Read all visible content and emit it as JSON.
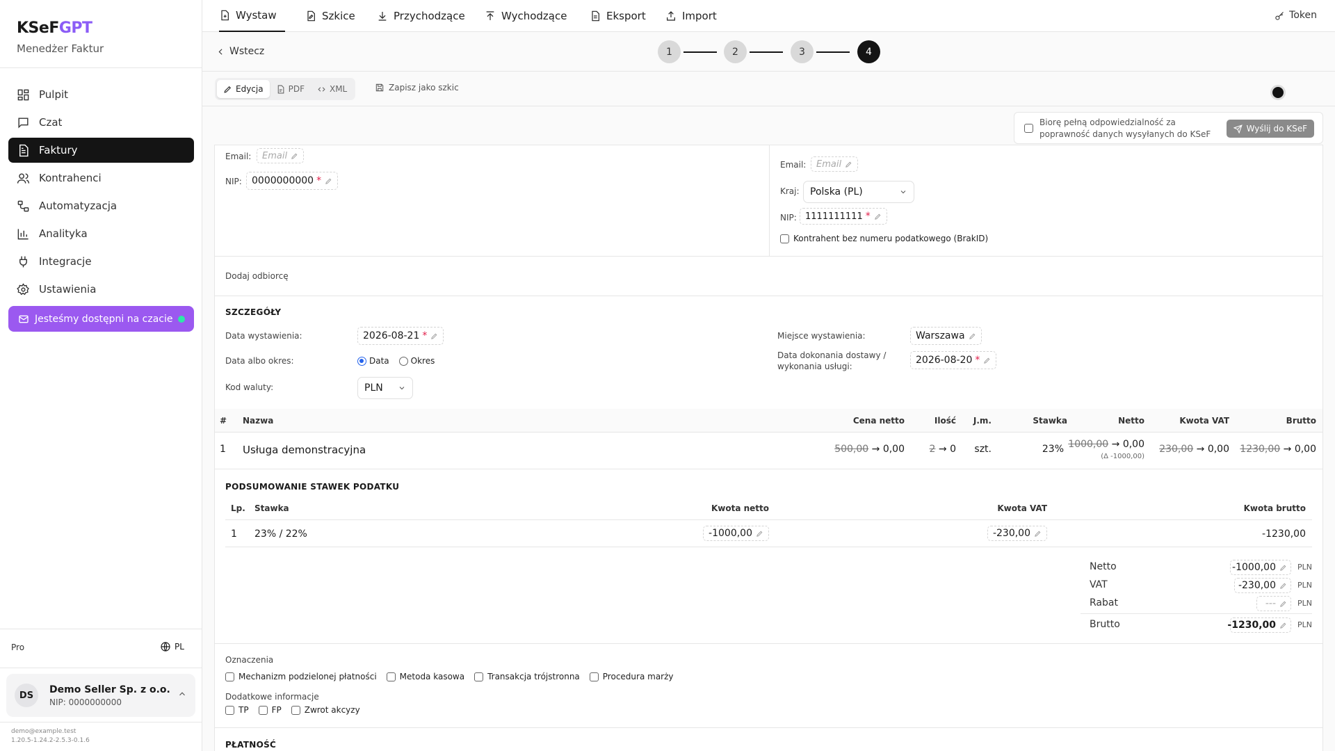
{
  "app": {
    "brand_main": "KSeF",
    "brand_accent": "GPT",
    "subtitle": "Menedżer Faktur"
  },
  "sidebar": {
    "items": [
      {
        "label": "Pulpit",
        "icon": "dashboard-icon"
      },
      {
        "label": "Czat",
        "icon": "chat-icon"
      },
      {
        "label": "Faktury",
        "icon": "invoice-icon",
        "active": true
      },
      {
        "label": "Kontrahenci",
        "icon": "users-icon"
      },
      {
        "label": "Automatyzacja",
        "icon": "workflow-icon"
      },
      {
        "label": "Analityka",
        "icon": "analytics-icon"
      },
      {
        "label": "Integracje",
        "icon": "plug-icon"
      },
      {
        "label": "Ustawienia",
        "icon": "gear-icon"
      }
    ],
    "chat_cta": "Jesteśmy dostępni na czacie",
    "plan": "Pro",
    "language": "PL",
    "user": {
      "initials": "DS",
      "name": "Demo Seller Sp. z o.o.",
      "nip": "NIP: 0000000000"
    },
    "email": "demo@example.test",
    "version": "1.20.5-1.24.2-2.5.3-0.1.6"
  },
  "topnav": {
    "tabs": [
      {
        "label": "Wystaw",
        "icon": "file-plus-icon",
        "active": true
      },
      {
        "label": "Szkice",
        "icon": "draft-icon"
      },
      {
        "label": "Przychodzące",
        "icon": "download-icon"
      },
      {
        "label": "Wychodzące",
        "icon": "upload-icon"
      },
      {
        "label": "Eksport",
        "icon": "export-icon"
      },
      {
        "label": "Import",
        "icon": "import-icon"
      }
    ],
    "token_label": "Token"
  },
  "wizard": {
    "back_label": "Wstecz",
    "steps": [
      "1",
      "2",
      "3",
      "4"
    ],
    "current_step": 4
  },
  "toolbar": {
    "modes": [
      {
        "label": "Edycja",
        "icon": "pencil-icon",
        "active": true
      },
      {
        "label": "PDF",
        "icon": "pdf-icon"
      },
      {
        "label": "XML",
        "icon": "code-icon"
      }
    ],
    "save_draft": "Zapisz jako szkic"
  },
  "send": {
    "confirm_text": "Biorę pełną odpowiedzialność za poprawność danych wysyłanych do KSeF",
    "button": "Wyślij do KSeF",
    "confirmed": false
  },
  "seller": {
    "email_label": "Email:",
    "email_placeholder": "Email",
    "nip_label": "NIP:",
    "nip": "0000000000"
  },
  "buyer": {
    "email_label": "Email:",
    "email_placeholder": "Email",
    "country_label": "Kraj:",
    "country": "Polska (PL)",
    "nip_label": "NIP:",
    "nip": "1111111111",
    "no_tax_id_label": "Kontrahent bez numeru podatkowego (BrakID)",
    "no_tax_id": false
  },
  "add_recipient": "Dodaj odbiorcę",
  "details": {
    "title": "SZCZEGÓŁY",
    "issue_date_label": "Data wystawienia:",
    "issue_date": "2026-08-21",
    "date_or_period_label": "Data albo okres:",
    "date_option": "Data",
    "period_option": "Okres",
    "selected": "Data",
    "currency_label": "Kod waluty:",
    "currency": "PLN",
    "place_label": "Miejsce wystawienia:",
    "place": "Warszawa",
    "delivery_label_1": "Data dokonania dostawy /",
    "delivery_label_2": "wykonania usługi:",
    "delivery_date": "2026-08-20"
  },
  "items_table": {
    "headers": {
      "idx": "#",
      "name": "Nazwa",
      "net_price": "Cena netto",
      "qty": "Ilość",
      "unit": "J.m.",
      "rate": "Stawka",
      "net": "Netto",
      "vat": "Kwota VAT",
      "gross": "Brutto"
    },
    "rows": [
      {
        "idx": "1",
        "name": "Usługa demonstracyjna",
        "net_price_old": "500,00",
        "net_price_new": "→ 0,00",
        "qty_old": "2",
        "qty_new": "→ 0",
        "unit": "szt.",
        "rate": "23%",
        "net_old": "1000,00",
        "net_new": "→ 0,00",
        "net_delta": "(Δ -1000,00)",
        "vat_old": "230,00",
        "vat_new": "→ 0,00",
        "gross_old": "1230,00",
        "gross_new": "→ 0,00"
      }
    ]
  },
  "tax_summary": {
    "title": "PODSUMOWANIE STAWEK PODATKU",
    "headers": {
      "lp": "Lp.",
      "rate": "Stawka",
      "net": "Kwota netto",
      "vat": "Kwota VAT",
      "gross": "Kwota brutto"
    },
    "rows": [
      {
        "lp": "1",
        "rate": "23% / 22%",
        "net": "-1000,00",
        "vat": "-230,00",
        "gross": "-1230,00"
      }
    ]
  },
  "totals": {
    "currency": "PLN",
    "netto_label": "Netto",
    "netto": "-1000,00",
    "vat_label": "VAT",
    "vat": "-230,00",
    "rabat_label": "Rabat",
    "rabat": "---",
    "brutto_label": "Brutto",
    "brutto": "-1230,00"
  },
  "flags": {
    "title": "Oznaczenia",
    "items": [
      "Mechanizm podzielonej płatności",
      "Metoda kasowa",
      "Transakcja trójstronna",
      "Procedura marży"
    ],
    "additional_title": "Dodatkowe informacje",
    "additional": [
      "TP",
      "FP",
      "Zwrot akcyzy"
    ]
  },
  "payment": {
    "title": "PŁATNOŚĆ"
  },
  "colors": {
    "accent": "#8b5cf6",
    "chat_button": "#9b59f0",
    "active_nav": "#141414",
    "required": "#e11d48",
    "online_dot": "#2ee6a8"
  }
}
